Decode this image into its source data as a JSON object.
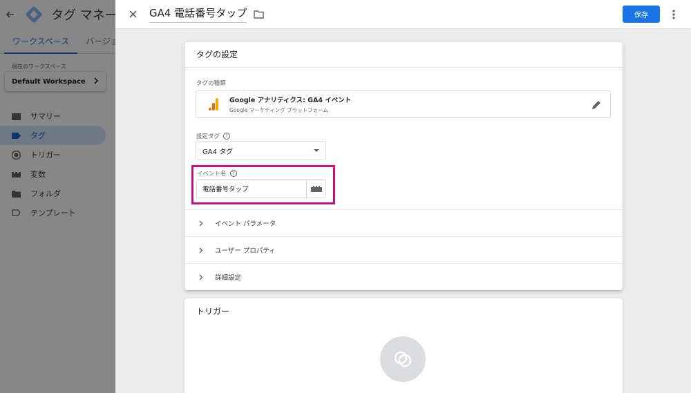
{
  "app": {
    "title": "タグ マネージャー",
    "tabs": [
      "ワークスペース",
      "バージョン"
    ],
    "workspace_label": "現在のワークスペース",
    "workspace_name": "Default Workspace",
    "nav": [
      {
        "label": "サマリー",
        "icon": "summary-icon"
      },
      {
        "label": "タグ",
        "icon": "tag-icon"
      },
      {
        "label": "トリガー",
        "icon": "trigger-icon"
      },
      {
        "label": "変数",
        "icon": "variables-icon"
      },
      {
        "label": "フォルダ",
        "icon": "folder-icon"
      },
      {
        "label": "テンプレート",
        "icon": "template-icon"
      }
    ],
    "active_nav": "タグ"
  },
  "sheet": {
    "title": "GA4 電話番号タップ",
    "save_label": "保存",
    "card_title": "タグの設定",
    "tag_type_label": "タグの種類",
    "tag_type_name": "Google アナリティクス: GA4 イベント",
    "tag_type_sub": "Google マーケティング プラットフォーム",
    "config_tag_label": "設定タグ",
    "config_tag_value": "GA4 タグ",
    "event_name_label": "イベント名",
    "event_name_value": "電話番号タップ",
    "sections": [
      "イベント パラメータ",
      "ユーザー プロパティ",
      "詳細設定"
    ],
    "trigger_title": "トリガー"
  },
  "colors": {
    "accent": "#1a73e8",
    "highlight": "#c8137e",
    "ga_orange": "#f9ab00",
    "ga_dark_orange": "#e37400"
  }
}
